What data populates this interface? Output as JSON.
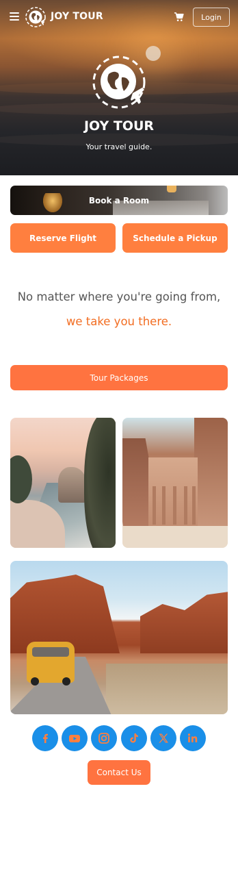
{
  "header": {
    "brand": "JOY TOUR",
    "login_label": "Login"
  },
  "hero": {
    "title": "JOY TOUR",
    "subtitle": "Your travel guide."
  },
  "actions": {
    "book_room": "Book a Room",
    "reserve_flight": "Reserve Flight",
    "schedule_pickup": "Schedule a Pickup"
  },
  "tagline": {
    "line1": "No matter where you're going from,",
    "line2": "we take you there."
  },
  "tour_packages_label": "Tour Packages",
  "social": [
    "facebook-icon",
    "youtube-icon",
    "instagram-icon",
    "tiktok-icon",
    "x-icon",
    "linkedin-icon"
  ],
  "contact_label": "Contact Us",
  "colors": {
    "accent": "#ff7f3f",
    "tagline_accent": "#f26d22",
    "social": "#1a8fe8"
  }
}
